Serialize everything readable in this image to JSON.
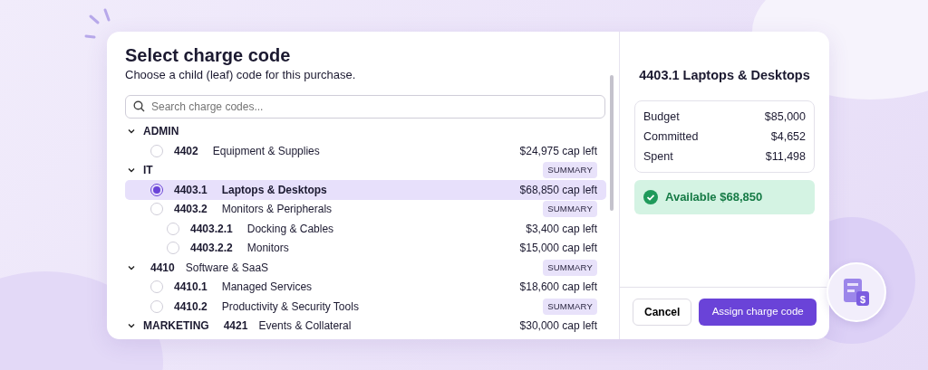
{
  "dialog": {
    "title": "Select charge code",
    "subtitle": "Choose a child (leaf) code for this purchase.",
    "search": {
      "placeholder": "Search charge codes..."
    },
    "tree": [
      {
        "kind": "group",
        "label": "ADMIN",
        "expanded": true,
        "children": [
          {
            "kind": "item",
            "code": "4402",
            "name": "Equipment & Supplies",
            "selected": false,
            "cap": "$24,975 cap left"
          }
        ]
      },
      {
        "kind": "group",
        "label": "IT",
        "expanded": true,
        "tag": "SUMMARY",
        "children": [
          {
            "kind": "item",
            "code": "4403.1",
            "name": "Laptops & Desktops",
            "selected": true,
            "cap": "$68,850 cap left"
          },
          {
            "kind": "item",
            "code": "4403.2",
            "name": "Monitors & Peripherals",
            "selected": false,
            "tag": "SUMMARY",
            "children": [
              {
                "kind": "item",
                "code": "4403.2.1",
                "name": "Docking & Cables",
                "selected": false,
                "cap": "$3,400 cap left"
              },
              {
                "kind": "item",
                "code": "4403.2.2",
                "name": "Monitors",
                "selected": false,
                "cap": "$15,000 cap left"
              }
            ]
          }
        ]
      },
      {
        "kind": "group",
        "code": "4410",
        "name": "Software & SaaS",
        "expanded": true,
        "tag": "SUMMARY",
        "children": [
          {
            "kind": "item",
            "code": "4410.1",
            "name": "Managed Services",
            "selected": false,
            "cap": "$18,600 cap left"
          },
          {
            "kind": "item",
            "code": "4410.2",
            "name": "Productivity & Security Tools",
            "selected": false,
            "tag": "SUMMARY"
          }
        ]
      },
      {
        "kind": "group",
        "label": "MARKETING",
        "code": "4421",
        "name": "Events & Collateral",
        "expanded": true,
        "cap": "$30,000 cap left"
      }
    ],
    "detail": {
      "title": "4403.1 Laptops & Desktops",
      "stats": [
        {
          "label": "Budget",
          "value": "$85,000"
        },
        {
          "label": "Committed",
          "value": "$4,652"
        },
        {
          "label": "Spent",
          "value": "$11,498"
        }
      ],
      "available": "Available $68,850"
    },
    "buttons": [
      {
        "label": "Cancel",
        "kind": "secondary"
      },
      {
        "label": "Assign charge code",
        "kind": "primary"
      }
    ]
  },
  "badge": {
    "symbol": "$"
  }
}
